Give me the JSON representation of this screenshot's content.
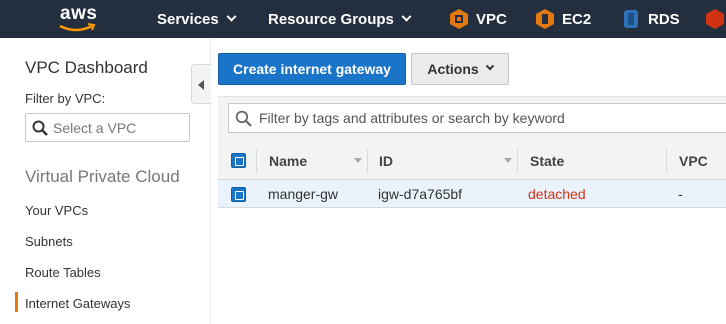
{
  "nav": {
    "logo_text": "aws",
    "services": "Services",
    "resource_groups": "Resource Groups",
    "shortcuts": [
      {
        "label": "VPC",
        "icon": "vpc-icon",
        "color": "#e47911"
      },
      {
        "label": "EC2",
        "icon": "ec2-icon",
        "color": "#e47911"
      },
      {
        "label": "RDS",
        "icon": "rds-icon",
        "color": "#2e73b8"
      }
    ]
  },
  "sidebar": {
    "title": "VPC Dashboard",
    "filter_label": "Filter by VPC:",
    "filter_placeholder": "Select a VPC",
    "section": "Virtual Private Cloud",
    "links": [
      "Your VPCs",
      "Subnets",
      "Route Tables",
      "Internet Gateways"
    ],
    "active_link": "Internet Gateways"
  },
  "toolbar": {
    "create_label": "Create internet gateway",
    "actions_label": "Actions"
  },
  "filter": {
    "placeholder": "Filter by tags and attributes or search by keyword"
  },
  "table": {
    "columns": [
      "Name",
      "ID",
      "State",
      "VPC"
    ],
    "rows": [
      {
        "name": "manger-gw",
        "id": "igw-d7a765bf",
        "state": "detached",
        "vpc": "-"
      }
    ]
  },
  "colors": {
    "nav_bg": "#232f3e",
    "primary": "#1a74c8",
    "detached": "#d13212",
    "active_marker": "#e47911"
  }
}
